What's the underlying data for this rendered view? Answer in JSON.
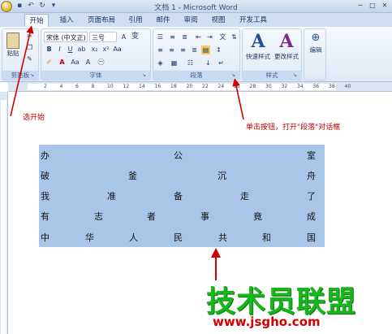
{
  "window": {
    "title": "文档 1 - Microsoft Word"
  },
  "tabs": [
    "开始",
    "插入",
    "页面布局",
    "引用",
    "邮件",
    "审阅",
    "视图",
    "开发工具"
  ],
  "ribbon": {
    "clipboard": {
      "label": "剪贴板",
      "paste": "粘贴"
    },
    "font": {
      "label": "字体",
      "font_name": "宋体 (中文正)",
      "font_size": "三号",
      "bold": "B",
      "italic": "I",
      "underline": "U",
      "grow": "A",
      "wen": "变",
      "color_a": "A"
    },
    "paragraph": {
      "label": "段落"
    },
    "styles": {
      "label": "样式",
      "quick_styles": "快速样式",
      "change_styles": "更改样式",
      "glyph": "A"
    },
    "editing": {
      "label": "编辑"
    }
  },
  "ruler": {
    "ticks": [
      "2",
      "4",
      "6",
      "8",
      "10",
      "12",
      "14",
      "16",
      "18",
      "20",
      "22",
      "24",
      "26",
      "28",
      "30",
      "32",
      "34",
      "36",
      "38",
      "40"
    ]
  },
  "annotations": {
    "select_start": "选开始",
    "click_button": "单击按钮，打开\"段落\"对话框"
  },
  "table_rows": [
    [
      "办",
      "公",
      "室"
    ],
    [
      "破",
      "釜",
      "沉",
      "舟"
    ],
    [
      "我",
      "准",
      "备",
      "走",
      "了"
    ],
    [
      "有",
      "志",
      "者",
      "事",
      "竟",
      "成"
    ],
    [
      "中",
      "华",
      "人",
      "民",
      "共",
      "和",
      "国"
    ]
  ],
  "watermark": {
    "title": "技术员联盟",
    "url": "www.jsgho.com"
  }
}
